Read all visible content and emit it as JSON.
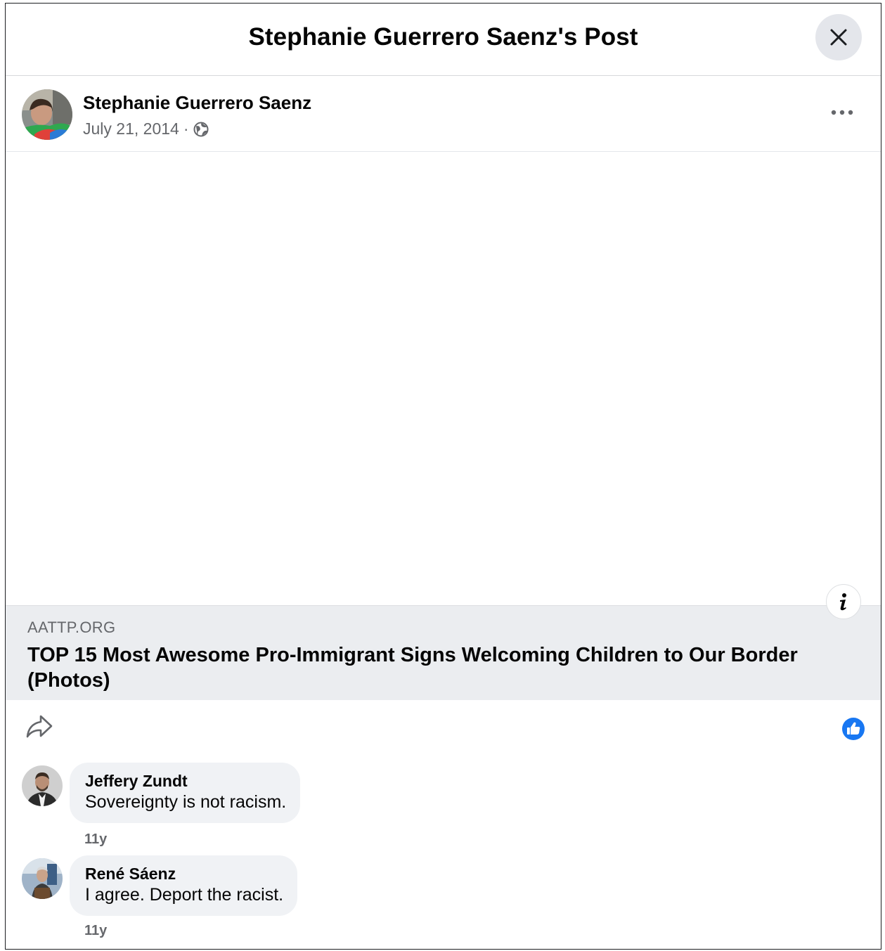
{
  "dialog": {
    "title": "Stephanie Guerrero Saenz's Post"
  },
  "post": {
    "author": "Stephanie Guerrero Saenz",
    "date": "July 21, 2014",
    "separator": "·",
    "privacy_icon": "globe-icon",
    "more_icon": "more-options-icon"
  },
  "link_preview": {
    "domain": "AATTP.ORG",
    "title": "TOP 15 Most Awesome Pro-Immigrant Signs Welcoming Children to Our Border (Photos)",
    "info_icon": "info-icon"
  },
  "actions": {
    "share_icon": "share-icon",
    "like_icon": "like-thumb-icon"
  },
  "comments": [
    {
      "author": "Jeffery Zundt",
      "text": "Sovereignty is not racism.",
      "time": "11y"
    },
    {
      "author": "René Sáenz",
      "text": "I agree. Deport the racist.",
      "time": "11y"
    }
  ],
  "colors": {
    "accent": "#1877f2",
    "secondary_text": "#65676b",
    "bubble_bg": "#f0f2f5",
    "card_bg": "#ebedf0"
  }
}
